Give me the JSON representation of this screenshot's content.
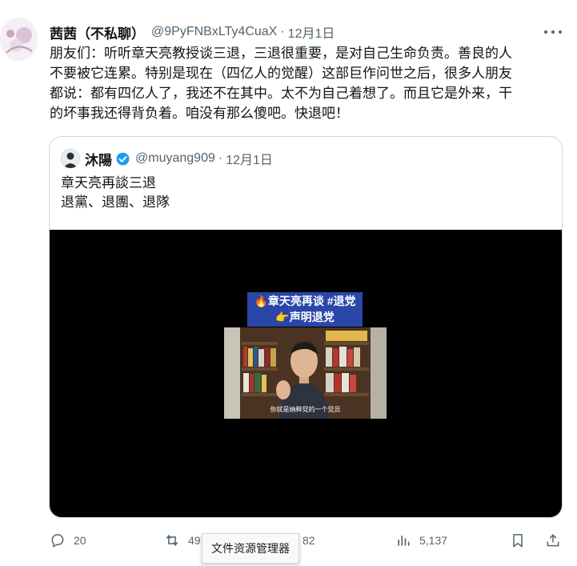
{
  "post": {
    "author_name": "茜茜（不私聊）",
    "author_handle": "@9PyFNBxLTy4CuaX",
    "separator": "·",
    "date": "12月1日",
    "text": "朋友们：听听章天亮教授谈三退，三退很重要，是对自己生命负责。善良的人\n不要被它连累。特别是现在（四亿人的觉醒）这部巨作问世之后，很多人朋友\n都说：都有四亿人了，我还不在其中。太不为自己着想了。而且它是外来，干\n的坏事我还得背负着。咱没有那么傻吧。快退吧！"
  },
  "quote": {
    "author_name": "沐陽",
    "author_handle": "@muyang909",
    "separator": "·",
    "date": "12月1日",
    "text": "章天亮再談三退\n退黨、退團、退隊",
    "video": {
      "label_line1": "🔥章天亮再谈 #退党",
      "label_line2": "👉声明退党",
      "subtitle": "你就是纳粹党的一个党员"
    }
  },
  "actions": {
    "replies": "20",
    "reposts": "49",
    "likes": "82",
    "views": "5,137"
  },
  "tooltip": "文件资源管理器",
  "colors": {
    "verified": "#1d9bf0",
    "muted": "#536471",
    "video_label_bg": "#2946a8"
  }
}
